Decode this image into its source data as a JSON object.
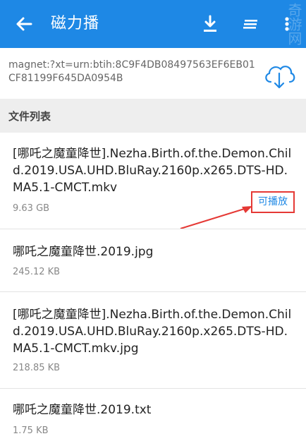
{
  "appbar": {
    "title": "磁力播",
    "watermark": "奇游网",
    "icons": {
      "back": "arrow-left-icon",
      "download": "download-icon",
      "sort": "sort-icon",
      "more": "more-vert-icon"
    },
    "color": "#1e88e5"
  },
  "magnet": {
    "link": "magnet:?xt=urn:btih:8C9F4DB08497563EF6EB01CF81199F645DA0954B",
    "icon": "cloud-download-icon"
  },
  "file_list": {
    "header": "文件列表",
    "files": [
      {
        "name": "[哪吒之魔童降世].Nezha.Birth.of.the.Demon.Child.2019.USA.UHD.BluRay.2160p.x265.DTS-HD.MA5.1-CMCT.mkv",
        "size": "9.63 GB",
        "badge": "可播放"
      },
      {
        "name": "哪吒之魔童降世.2019.jpg",
        "size": "245.12 KB"
      },
      {
        "name": "[哪吒之魔童降世].Nezha.Birth.of.the.Demon.Child.2019.USA.UHD.BluRay.2160p.x265.DTS-HD.MA5.1-CMCT.mkv.jpg",
        "size": "218.85 KB"
      },
      {
        "name": "哪吒之魔童降世.2019.txt",
        "size": "1.75 KB"
      }
    ]
  },
  "annotation_color": "#e53935"
}
